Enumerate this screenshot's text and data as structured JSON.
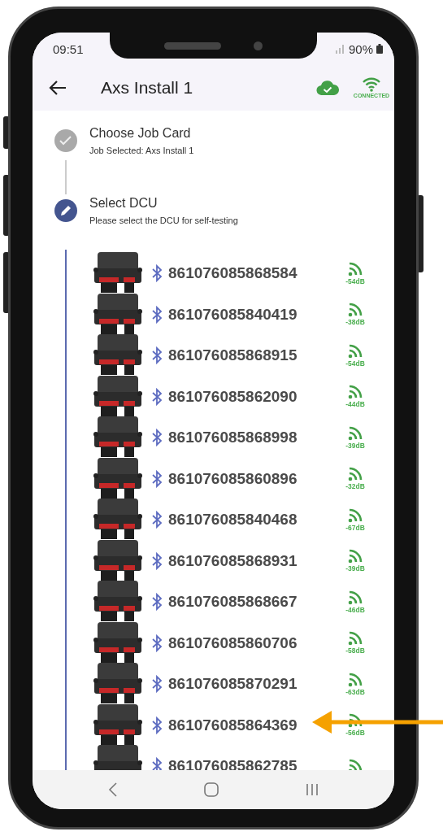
{
  "status_bar": {
    "time": "09:51",
    "battery": "90%"
  },
  "app_bar": {
    "title": "Axs Install 1",
    "connection": "CONNECTED"
  },
  "steps": [
    {
      "title": "Choose Job Card",
      "subtitle": "Job Selected: Axs Install 1",
      "done": true
    },
    {
      "title": "Select DCU",
      "subtitle": "Please select the DCU for self-testing",
      "done": false
    }
  ],
  "devices": [
    {
      "id": "861076085868584",
      "signal": "-54dB"
    },
    {
      "id": "861076085840419",
      "signal": "-38dB"
    },
    {
      "id": "861076085868915",
      "signal": "-54dB"
    },
    {
      "id": "861076085862090",
      "signal": "-44dB"
    },
    {
      "id": "861076085868998",
      "signal": "-39dB"
    },
    {
      "id": "861076085860896",
      "signal": "-32dB"
    },
    {
      "id": "861076085840468",
      "signal": "-67dB"
    },
    {
      "id": "861076085868931",
      "signal": "-39dB"
    },
    {
      "id": "861076085868667",
      "signal": "-46dB"
    },
    {
      "id": "861076085860706",
      "signal": "-58dB"
    },
    {
      "id": "861076085870291",
      "signal": "-63dB"
    },
    {
      "id": "861076085864369",
      "signal": "-56dB"
    },
    {
      "id": "861076085862785"
    }
  ]
}
